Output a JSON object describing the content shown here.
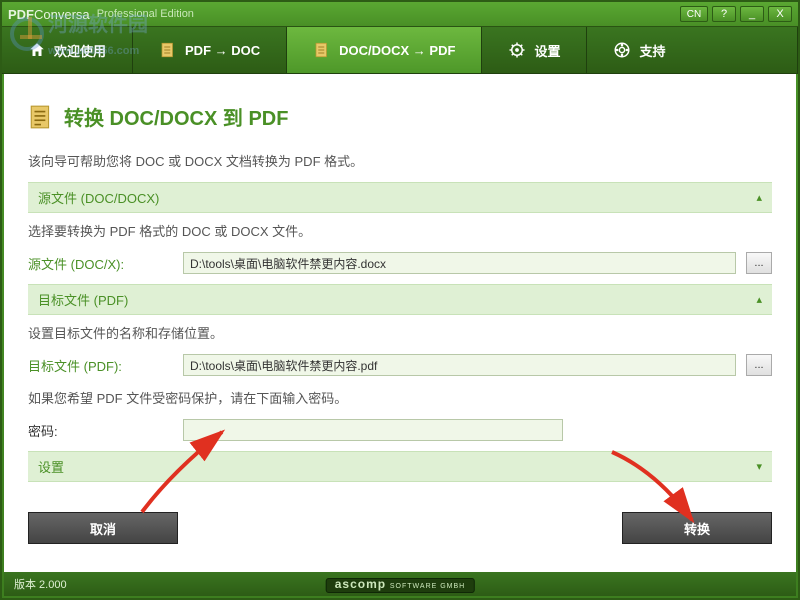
{
  "titlebar": {
    "app_name_prefix": "PDF",
    "app_name": " Conversa",
    "edition": "Professional Edition",
    "lang_btn": "CN",
    "minimize": "_",
    "maximize": "□",
    "close": "X"
  },
  "tabs": [
    {
      "label": "欢迎使用",
      "icon": "home-icon"
    },
    {
      "label": "PDF → DOC",
      "icon": "doc-icon"
    },
    {
      "label": "DOC/DOCX → PDF",
      "icon": "doc-icon",
      "active": true
    },
    {
      "label": "设置",
      "icon": "gear-icon"
    },
    {
      "label": "支持",
      "icon": "support-icon"
    }
  ],
  "page": {
    "title": "转换 DOC/DOCX 到 PDF",
    "intro": "该向导可帮助您将 DOC 或 DOCX 文档转换为 PDF 格式。"
  },
  "sections": {
    "source": {
      "header": "源文件 (DOC/DOCX)",
      "hint": "选择要转换为 PDF 格式的 DOC 或 DOCX 文件。",
      "field_label": "源文件 (DOC/X):",
      "value": "D:\\tools\\桌面\\电脑软件禁更内容.docx",
      "browse": "..."
    },
    "target": {
      "header": "目标文件 (PDF)",
      "hint": "设置目标文件的名称和存储位置。",
      "field_label": "目标文件 (PDF):",
      "value": "D:\\tools\\桌面\\电脑软件禁更内容.pdf",
      "browse": "...",
      "pw_hint": "如果您希望 PDF 文件受密码保护，请在下面输入密码。",
      "pw_label": "密码:",
      "pw_value": ""
    },
    "settings": {
      "header": "设置"
    }
  },
  "buttons": {
    "cancel": "取消",
    "convert": "转换"
  },
  "statusbar": {
    "version": "版本 2.000",
    "brand": "ascomp",
    "brand_sub": "SOFTWARE GMBH"
  },
  "watermark": {
    "text": "河源软件园",
    "sub": "www.pc0356.com"
  },
  "colors": {
    "accent": "#4a9026",
    "panel": "#dff0d4"
  }
}
